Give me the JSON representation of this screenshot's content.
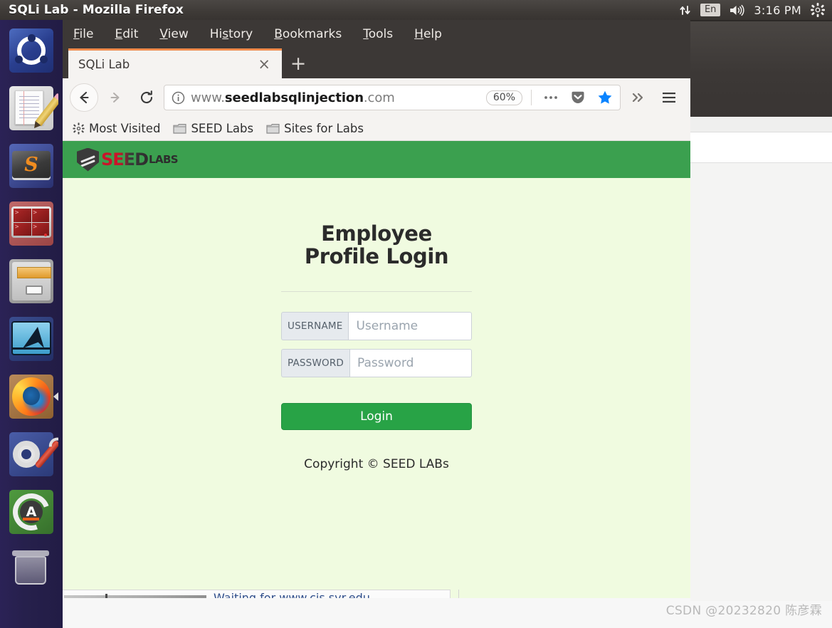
{
  "window": {
    "title": "SQLi Lab - Mozilla Firefox"
  },
  "tray": {
    "network_icon": "network-up-down-icon",
    "language": "En",
    "volume_icon": "volume-icon",
    "clock": "3:16 PM",
    "settings_icon": "gear-icon"
  },
  "launcher": {
    "items": [
      {
        "name": "ubuntu-dash",
        "label": "Ubuntu Dash"
      },
      {
        "name": "text-editor",
        "label": "Text Editor"
      },
      {
        "name": "sublime-text",
        "label": "Sublime Text"
      },
      {
        "name": "terminal",
        "label": "Terminal"
      },
      {
        "name": "files",
        "label": "Files"
      },
      {
        "name": "wireshark",
        "label": "Wireshark"
      },
      {
        "name": "firefox",
        "label": "Firefox"
      },
      {
        "name": "system-settings",
        "label": "System Settings"
      },
      {
        "name": "software-updater",
        "label": "Software Updater"
      },
      {
        "name": "trash",
        "label": "Trash"
      }
    ]
  },
  "menubar": {
    "items": [
      {
        "label": "File",
        "accel": "F"
      },
      {
        "label": "Edit",
        "accel": "E"
      },
      {
        "label": "View",
        "accel": "V"
      },
      {
        "label": "History",
        "accel": "s"
      },
      {
        "label": "Bookmarks",
        "accel": "B"
      },
      {
        "label": "Tools",
        "accel": "T"
      },
      {
        "label": "Help",
        "accel": "H"
      }
    ]
  },
  "tabs": {
    "active": {
      "title": "SQLi Lab",
      "close_label": "×"
    },
    "new_tab_label": "+"
  },
  "navbar": {
    "back_icon": "back-arrow-icon",
    "forward_icon": "forward-arrow-icon",
    "reload_icon": "reload-icon",
    "identity_icon": "info-circle-icon",
    "url_prefix": "www.",
    "url_domain": "seedlabsqlinjection",
    "url_suffix": ".com",
    "url_full": "www.seedlabsqlinjection.com",
    "zoom_level": "60%",
    "page_actions_icon": "ellipsis-icon",
    "pocket_icon": "pocket-shield-icon",
    "bookmark_icon": "star-filled-icon",
    "overflow_icon": "chevron-double-right-icon",
    "menu_icon": "hamburger-menu-icon"
  },
  "bookmarks": [
    {
      "icon": "most-visited-icon",
      "label": "Most Visited"
    },
    {
      "icon": "folder-icon",
      "label": "SEED Labs"
    },
    {
      "icon": "folder-icon",
      "label": "Sites for Labs"
    }
  ],
  "page": {
    "brand": {
      "seed": "SEED",
      "labs": "LABS",
      "shield_icon": "seed-shield-icon"
    },
    "heading": "Employee Profile Login",
    "username": {
      "addon": "USERNAME",
      "placeholder": "Username",
      "value": ""
    },
    "password": {
      "addon": "PASSWORD",
      "placeholder": "Password",
      "value": ""
    },
    "login_button": "Login",
    "copyright": "Copyright © SEED LABs"
  },
  "status": {
    "text": "Waiting for www.cis.syr.edu..."
  },
  "watermark": "CSDN @20232820 陈彦霖",
  "colors": {
    "panel": "#3c3836",
    "launcher": "#261f4c",
    "seed_green": "#3ba04f",
    "page_bg": "#f0fbe0",
    "login_button": "#28a346",
    "tab_accent": "#f08a4b",
    "star_blue": "#0a84ff"
  }
}
